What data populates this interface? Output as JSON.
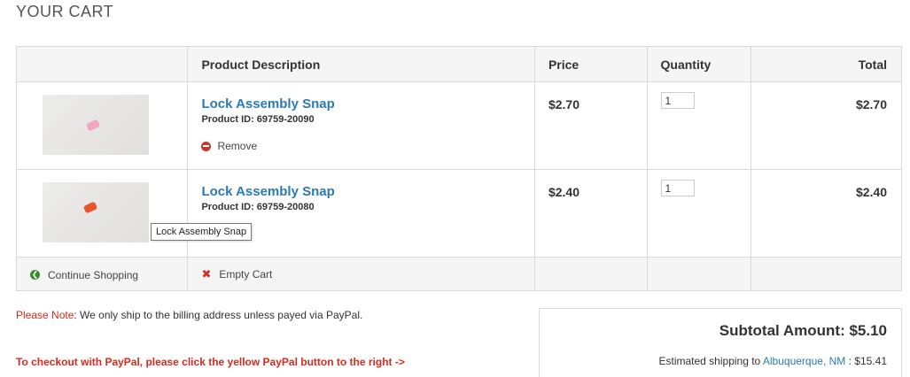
{
  "page_title": "YOUR CART",
  "table": {
    "headers": {
      "image": "",
      "description": "Product Description",
      "price": "Price",
      "quantity": "Quantity",
      "total": "Total"
    },
    "items": [
      {
        "name": "Lock Assembly Snap",
        "product_id": "Product ID: 69759-20090",
        "remove_label": "Remove",
        "price": "$2.70",
        "quantity": "1",
        "total": "$2.70",
        "thumb_color": "#f0a7c4"
      },
      {
        "name": "Lock Assembly Snap",
        "product_id": "Product ID: 69759-20080",
        "price": "$2.40",
        "quantity": "1",
        "total": "$2.40",
        "thumb_color": "#e8552b"
      }
    ],
    "actions": {
      "continue_label": "Continue Shopping",
      "empty_label": "Empty Cart"
    }
  },
  "tooltip": "Lock Assembly Snap",
  "note": {
    "label": "Please Note",
    "text": ": We only ship to the billing address unless payed via PayPal."
  },
  "paypal_instruction": "To checkout with PayPal, please click the yellow PayPal button to the right ->",
  "summary": {
    "subtotal": "Subtotal Amount: $5.10",
    "shipping_prefix": "Estimated shipping to ",
    "shipping_location": "Albuquerque, NM",
    "shipping_suffix": " : $15.41"
  },
  "colors": {
    "link": "#2a7bb5",
    "alert_red": "#d62b1e",
    "continue_green": "#3a8a2e"
  }
}
